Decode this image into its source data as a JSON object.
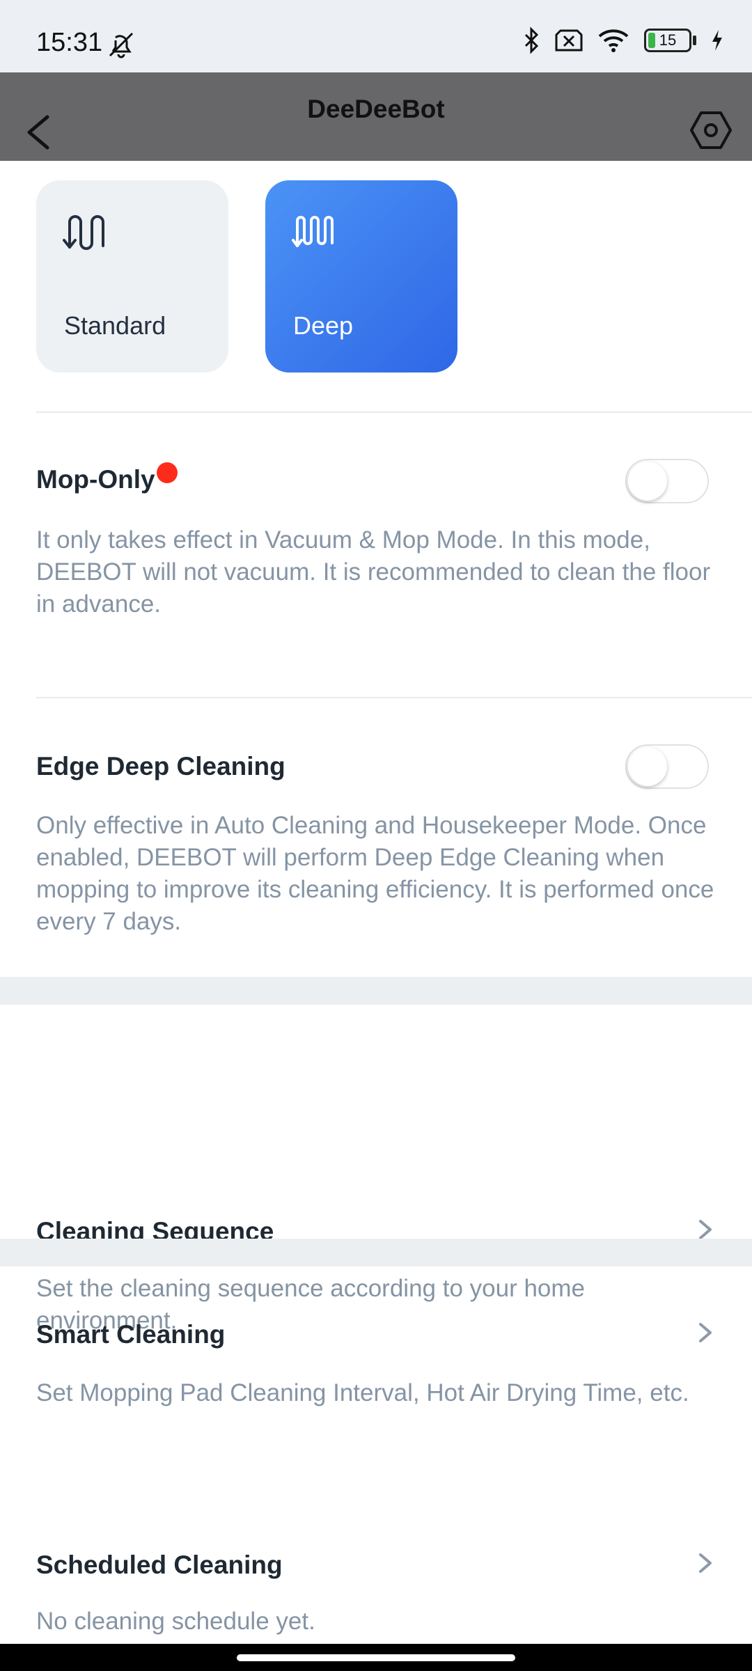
{
  "status_bar": {
    "time": "15:31",
    "battery_level": "15"
  },
  "header": {
    "title": "DeeDeeBot",
    "back_icon": "chevron-left-icon",
    "settings_icon": "hexagon-gear-icon"
  },
  "mop_modes": [
    {
      "label": "Standard",
      "icon": "mop-standard-icon",
      "selected": false
    },
    {
      "label": "Deep",
      "icon": "mop-deep-icon",
      "selected": true
    }
  ],
  "settings": {
    "mop_only": {
      "title": "Mop-Only",
      "description": "It only takes effect in Vacuum & Mop Mode. In this mode, DEEBOT will not vacuum. It is recommended to clean the floor in advance.",
      "enabled": false,
      "new_badge": true
    },
    "edge_deep_cleaning": {
      "title": "Edge Deep Cleaning",
      "description": "Only effective in Auto Cleaning and Housekeeper Mode. Once enabled, DEEBOT will perform Deep Edge Cleaning when mopping to improve its cleaning efficiency. It is performed once every 7 days.",
      "enabled": false
    },
    "cleaning_sequence": {
      "title": "Cleaning Sequence",
      "description": "Set the cleaning sequence according to your home environment."
    },
    "smart_cleaning": {
      "title": "Smart Cleaning",
      "description": "Set Mopping Pad Cleaning Interval, Hot Air Drying Time, etc."
    },
    "scheduled_cleaning": {
      "title": "Scheduled Cleaning",
      "description": "No cleaning schedule yet."
    }
  },
  "colors": {
    "accent": "#3b7cf0",
    "badge": "#ff2b1a",
    "description_text": "#8594a4",
    "header_bg": "#676769"
  }
}
